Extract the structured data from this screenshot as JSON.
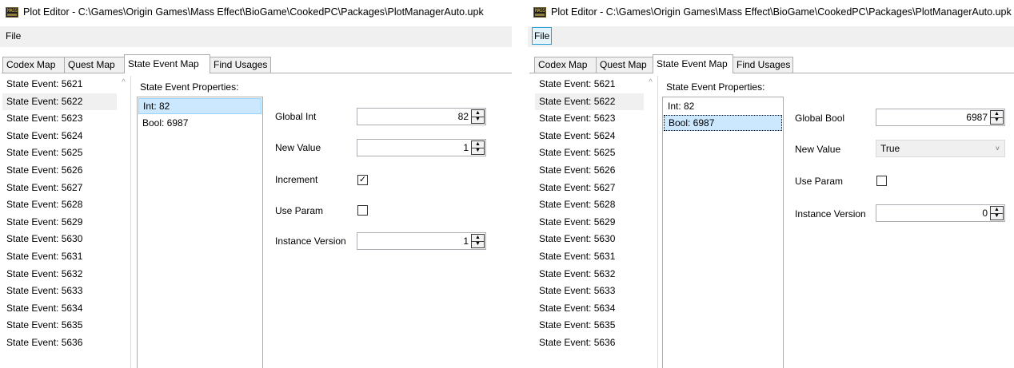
{
  "left": {
    "title": "Plot Editor - C:\\Games\\Origin Games\\Mass Effect\\BioGame\\CookedPC\\Packages\\PlotManagerAuto.upk",
    "icon_label": "MASS",
    "menu": {
      "file": "File"
    },
    "tabs": [
      "Codex Map",
      "Quest Map",
      "State Event Map",
      "Find Usages"
    ],
    "active_tab": "State Event Map",
    "events": [
      "State Event: 5621",
      "State Event: 5622",
      "State Event: 5623",
      "State Event: 5624",
      "State Event: 5625",
      "State Event: 5626",
      "State Event: 5627",
      "State Event: 5628",
      "State Event: 5629",
      "State Event: 5630",
      "State Event: 5631",
      "State Event: 5632",
      "State Event: 5633",
      "State Event: 5634",
      "State Event: 5635",
      "State Event: 5636"
    ],
    "selected_event": "State Event: 5622",
    "props_title": "State Event Properties:",
    "props": [
      "Int: 82",
      "Bool: 6987"
    ],
    "selected_prop": "Int: 82",
    "fields": {
      "global_int_label": "Global Int",
      "global_int_value": "82",
      "new_value_label": "New Value",
      "new_value_value": "1",
      "increment_label": "Increment",
      "increment_checked": true,
      "use_param_label": "Use Param",
      "use_param_checked": false,
      "instance_version_label": "Instance Version",
      "instance_version_value": "1"
    }
  },
  "right": {
    "title": "Plot Editor - C:\\Games\\Origin Games\\Mass Effect\\BioGame\\CookedPC\\Packages\\PlotManagerAuto.upk",
    "icon_label": "MASS",
    "menu": {
      "file": "File"
    },
    "tabs": [
      "Codex Map",
      "Quest Map",
      "State Event Map",
      "Find Usages"
    ],
    "active_tab": "State Event Map",
    "events": [
      "State Event: 5621",
      "State Event: 5622",
      "State Event: 5623",
      "State Event: 5624",
      "State Event: 5625",
      "State Event: 5626",
      "State Event: 5627",
      "State Event: 5628",
      "State Event: 5629",
      "State Event: 5630",
      "State Event: 5631",
      "State Event: 5632",
      "State Event: 5633",
      "State Event: 5634",
      "State Event: 5635",
      "State Event: 5636"
    ],
    "selected_event": "State Event: 5622",
    "props_title": "State Event Properties:",
    "props": [
      "Int: 82",
      "Bool: 6987"
    ],
    "selected_prop": "Bool: 6987",
    "fields": {
      "global_bool_label": "Global Bool",
      "global_bool_value": "6987",
      "new_value_label": "New Value",
      "new_value_value": "True",
      "use_param_label": "Use Param",
      "use_param_checked": false,
      "instance_version_label": "Instance Version",
      "instance_version_value": "0"
    }
  },
  "icons": {
    "checkbox_checked": "✓",
    "spin_up": "▲",
    "spin_down": "▼",
    "scroll_up": "^",
    "combo_arrow": "˅"
  },
  "colors": {
    "selection": "#cce8ff",
    "selection_border": "#99d1ff",
    "menu_highlight": "#e5f3fb",
    "menu_highlight_border": "#26a0da"
  }
}
